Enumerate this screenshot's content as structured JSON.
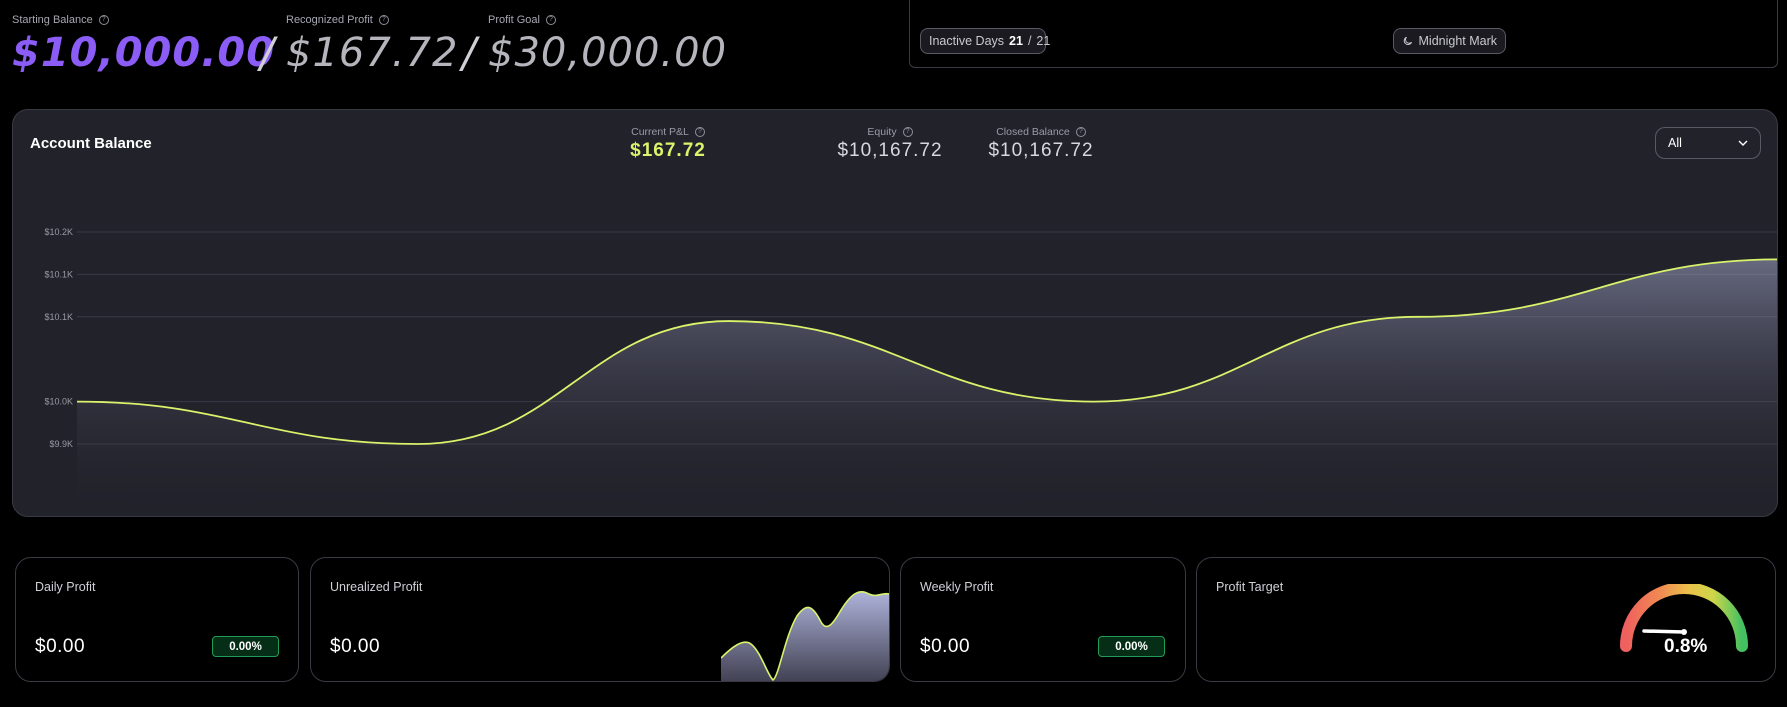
{
  "header": {
    "starting_balance": {
      "label": "Starting Balance",
      "value": "$10,000.00"
    },
    "recognized_profit": {
      "label": "Recognized Profit",
      "value": "$167.72"
    },
    "profit_goal": {
      "label": "Profit Goal",
      "value": "$30,000.00"
    },
    "separator": "/"
  },
  "status": {
    "inactive_days": {
      "label": "Inactive Days",
      "current": "21",
      "divider": "/",
      "total": "21"
    },
    "midnight_mark": {
      "label": "Midnight Mark",
      "icon": "moon-icon"
    }
  },
  "balance_card": {
    "title": "Account Balance",
    "current_pnl": {
      "label": "Current P&L",
      "value": "$167.72"
    },
    "equity": {
      "label": "Equity",
      "value": "$10,167.72"
    },
    "closed_balance": {
      "label": "Closed Balance",
      "value": "$10,167.72"
    },
    "range": {
      "selected": "All"
    }
  },
  "chart_data": {
    "type": "area",
    "title": "Account Balance",
    "y_ticks": [
      {
        "label": "$10.2K",
        "value": 10200
      },
      {
        "label": "$10.1K",
        "value": 10150
      },
      {
        "label": "$10.1K",
        "value": 10100
      },
      {
        "label": "$10.0K",
        "value": 10000
      },
      {
        "label": "$9.9K",
        "value": 9950
      }
    ],
    "ylim": [
      9950,
      10200
    ],
    "series": [
      {
        "values": [
          10000,
          9950,
          10095,
          10000,
          10100,
          10167.72
        ]
      }
    ],
    "line_color": "#d9f36a",
    "grid": true
  },
  "cards": {
    "daily_profit": {
      "title": "Daily Profit",
      "value": "$0.00",
      "change": "0.00%"
    },
    "unrealized_profit": {
      "title": "Unrealized Profit",
      "value": "$0.00"
    },
    "weekly_profit": {
      "title": "Weekly Profit",
      "value": "$0.00",
      "change": "0.00%"
    },
    "profit_target": {
      "title": "Profit Target",
      "value": "0.8%",
      "progress": 0.008
    }
  },
  "colors": {
    "accent_purple": "#8b5cf6",
    "accent_lime": "#d9f36a",
    "positive_green": "#1f9d55"
  }
}
